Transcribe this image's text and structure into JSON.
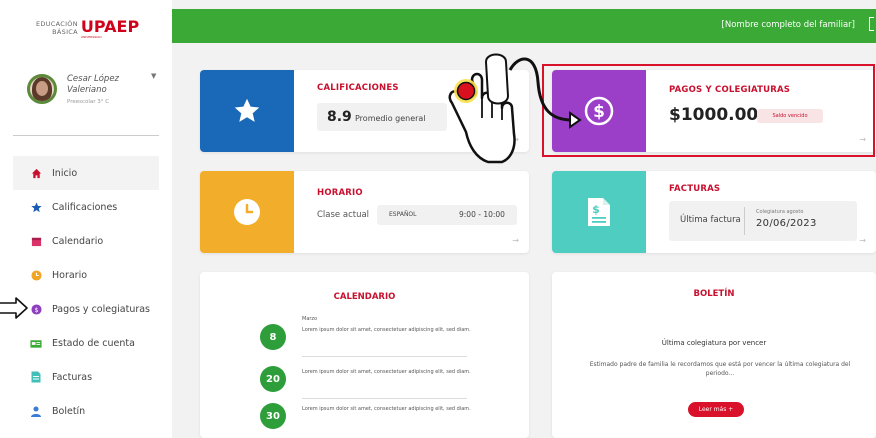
{
  "logo": {
    "line1": "EDUCACIÓN",
    "line2": "BÁSICA",
    "brand": "UPAEP",
    "tagline": "UNIVERSIDAD"
  },
  "profile": {
    "name_line1": "Cesar López",
    "name_line2": "Valeriano",
    "role": "Preescolar 3° C"
  },
  "nav": [
    {
      "label": "Inicio",
      "icon": "home-icon",
      "color": "#c8102e"
    },
    {
      "label": "Calificaciones",
      "icon": "star-icon",
      "color": "#1a5bb3"
    },
    {
      "label": "Calendario",
      "icon": "calendar-icon",
      "color": "#d9336a"
    },
    {
      "label": "Horario",
      "icon": "clock-icon",
      "color": "#f0a524"
    },
    {
      "label": "Pagos y colegiaturas",
      "icon": "dollar-icon",
      "color": "#8e3fbf"
    },
    {
      "label": "Estado de cuenta",
      "icon": "account-icon",
      "color": "#3aa935"
    },
    {
      "label": "Facturas",
      "icon": "invoice-icon",
      "color": "#40c0b8"
    },
    {
      "label": "Boletín",
      "icon": "report-icon",
      "color": "#3a7bd5"
    }
  ],
  "topbar": {
    "user": "[Nombre completo del familiar]"
  },
  "cards": {
    "grades": {
      "title": "CALIFICACIONES",
      "value": "8.9",
      "label": "Promedio general"
    },
    "payments": {
      "title": "PAGOS Y COLEGIATURAS",
      "amount": "$1000.00",
      "badge": "Saldo vencido"
    },
    "schedule": {
      "title": "HORARIO",
      "current_label": "Clase actual",
      "subject": "ESPAÑOL",
      "time": "9:00 - 10:00"
    },
    "invoices": {
      "title": "FACTURAS",
      "label": "Última factura",
      "sub": "Colegiatura agosto",
      "date": "20/06/2023"
    },
    "calendar": {
      "title": "CALENDARIO",
      "month": "Marzo",
      "events": [
        {
          "day": "8",
          "text": "Lorem ipsum dolor sit amet, consectetuer adipiscing elit, sed diam."
        },
        {
          "day": "20",
          "text": "Lorem ipsum dolor sit amet, consectetuer adipiscing elit, sed diam."
        },
        {
          "day": "30",
          "text": "Lorem ipsum dolor sit amet, consectetuer adipiscing elit, sed diam."
        }
      ]
    },
    "report": {
      "title": "BOLETÍN",
      "subtitle": "Última colegiatura por vencer",
      "text": "Estimado padre de familia le recordamos que está por vencer la última colegiatura del periodo...",
      "button": "Leer más +"
    }
  },
  "colors": {
    "green": "#3aa935",
    "red": "#c8102e",
    "blue": "#1a68b8",
    "yellow": "#f2ad2b",
    "purple": "#9b3fc8",
    "teal": "#4ecdc0"
  }
}
